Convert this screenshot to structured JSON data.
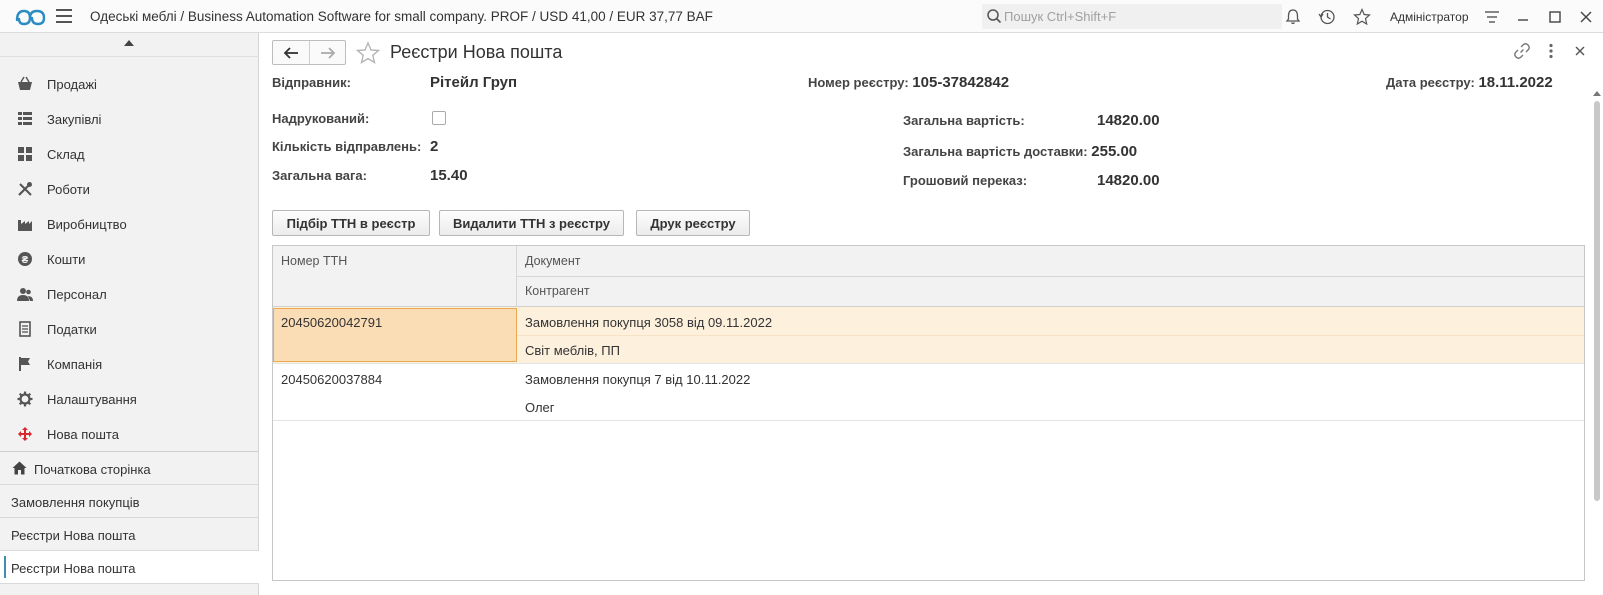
{
  "topbar": {
    "app_title": "Одеські меблі / Business Automation Software for small company. PROF / USD 41,00 / EUR 37,77 BAF",
    "search_placeholder": "Пошук Ctrl+Shift+F",
    "user": "Адміністратор",
    "accent": "#2b8cc4"
  },
  "sidebar": {
    "items": [
      {
        "label": "Продажі",
        "icon": "basket-icon"
      },
      {
        "label": "Закупівлі",
        "icon": "cart-icon"
      },
      {
        "label": "Склад",
        "icon": "grid-icon"
      },
      {
        "label": "Роботи",
        "icon": "tools-icon"
      },
      {
        "label": "Виробництво",
        "icon": "factory-icon"
      },
      {
        "label": "Кошти",
        "icon": "coins-icon"
      },
      {
        "label": "Персонал",
        "icon": "people-icon"
      },
      {
        "label": "Податки",
        "icon": "document-icon"
      },
      {
        "label": "Компанія",
        "icon": "flag-icon"
      },
      {
        "label": "Налаштування",
        "icon": "gear-icon"
      },
      {
        "label": "Нова пошта",
        "icon": "nova-poshta-icon"
      }
    ],
    "open_windows": [
      {
        "label": "Початкова сторінка"
      },
      {
        "label": "Замовлення покупців"
      },
      {
        "label": "Реєстри Нова пошта"
      },
      {
        "label": "Реєстри Нова пошта"
      }
    ]
  },
  "form": {
    "title": "Реєстри Нова пошта",
    "sender_label": "Відправник:",
    "sender_value": "Рітейл Груп",
    "registry_number_label": "Номер реєстру:",
    "registry_number_value": "105-37842842",
    "registry_date_label": "Дата реєстру:",
    "registry_date_value": "18.11.2022",
    "printed_label": "Надрукований:",
    "printed_checked": false,
    "shipments_count_label": "Кількість відправлень:",
    "shipments_count_value": "2",
    "total_weight_label": "Загальна вага:",
    "total_weight_value": "15.40",
    "total_cost_label": "Загальна вартість:",
    "total_cost_value": "14820.00",
    "delivery_cost_label": "Загальна вартість доставки:",
    "delivery_cost_value": "255.00",
    "money_transfer_label": "Грошовий переказ:",
    "money_transfer_value": "14820.00"
  },
  "buttons": {
    "pick_ttn": "Підбір ТТН в реєстр",
    "delete_ttn": "Видалити ТТН з реєстру",
    "print_registry": "Друк реєстру"
  },
  "table": {
    "col_ttn": "Номер ТТН",
    "col_document": "Документ",
    "col_counterparty": "Контрагент",
    "rows": [
      {
        "ttn": "20450620042791",
        "document": "Замовлення покупця 3058 від 09.11.2022",
        "counterparty": "Світ меблів, ПП"
      },
      {
        "ttn": "20450620037884",
        "document": "Замовлення покупця 7 від 10.11.2022",
        "counterparty": "Олег"
      }
    ]
  }
}
